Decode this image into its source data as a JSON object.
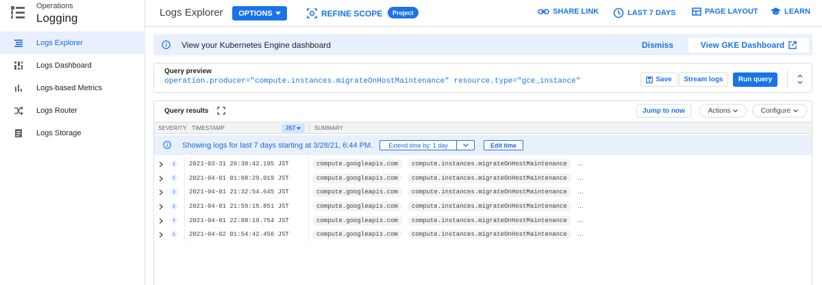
{
  "sidebar": {
    "product_super": "Operations",
    "product_name": "Logging",
    "items": [
      {
        "label": "Logs Explorer",
        "icon": "list-icon",
        "active": true
      },
      {
        "label": "Logs Dashboard",
        "icon": "dashboard-icon",
        "active": false
      },
      {
        "label": "Logs-based Metrics",
        "icon": "bar-chart-icon",
        "active": false
      },
      {
        "label": "Logs Router",
        "icon": "shuffle-icon",
        "active": false
      },
      {
        "label": "Logs Storage",
        "icon": "storage-icon",
        "active": false
      }
    ]
  },
  "header": {
    "title": "Logs Explorer",
    "options_label": "OPTIONS",
    "refine_scope_label": "REFINE SCOPE",
    "project_badge": "Project",
    "share_link": "SHARE LINK",
    "time_range": "LAST 7 DAYS",
    "page_layout": "PAGE LAYOUT",
    "learn": "LEARN"
  },
  "banner": {
    "text": "View your Kubernetes Engine dashboard",
    "dismiss": "Dismiss",
    "gke_button": "View GKE Dashboard"
  },
  "query": {
    "label": "Query preview",
    "text": "operation.producer=\"compute.instances.migrateOnHostMaintenance\" resource.type=\"gce_instance\"",
    "save": "Save",
    "stream": "Stream logs",
    "run": "Run query"
  },
  "results": {
    "title": "Query results",
    "jump_to_now": "Jump to now",
    "actions": "Actions",
    "configure": "Configure",
    "columns": {
      "severity": "SEVERITY",
      "timestamp": "TIMESTAMP",
      "timezone": "JST",
      "summary": "SUMMARY"
    },
    "info_text": "Showing logs for last 7 days starting at 3/28/21, 6:44 PM.",
    "extend_label": "Extend time by: 1 day",
    "edit_time": "Edit time",
    "rows": [
      {
        "severity": "i",
        "timestamp": "2021-03-31 20:38:42.195 JST",
        "service": "compute.googleapis.com",
        "method": "compute.instances.migrateOnHostMaintenance",
        "more": "…"
      },
      {
        "severity": "i",
        "timestamp": "2021-04-01 01:08:29.019 JST",
        "service": "compute.googleapis.com",
        "method": "compute.instances.migrateOnHostMaintenance",
        "more": "…"
      },
      {
        "severity": "i",
        "timestamp": "2021-04-01 21:32:54.645 JST",
        "service": "compute.googleapis.com",
        "method": "compute.instances.migrateOnHostMaintenance",
        "more": "…"
      },
      {
        "severity": "i",
        "timestamp": "2021-04-01 21:59:15.851 JST",
        "service": "compute.googleapis.com",
        "method": "compute.instances.migrateOnHostMaintenance",
        "more": "…"
      },
      {
        "severity": "i",
        "timestamp": "2021-04-01 22:08:19.754 JST",
        "service": "compute.googleapis.com",
        "method": "compute.instances.migrateOnHostMaintenance",
        "more": "…"
      },
      {
        "severity": "i",
        "timestamp": "2021-04-02 01:54:42.456 JST",
        "service": "compute.googleapis.com",
        "method": "compute.instances.migrateOnHostMaintenance",
        "more": "…"
      }
    ]
  },
  "colors": {
    "accent": "#1a73e8",
    "active_bg": "#e8f0fe",
    "border": "#dadce0"
  }
}
